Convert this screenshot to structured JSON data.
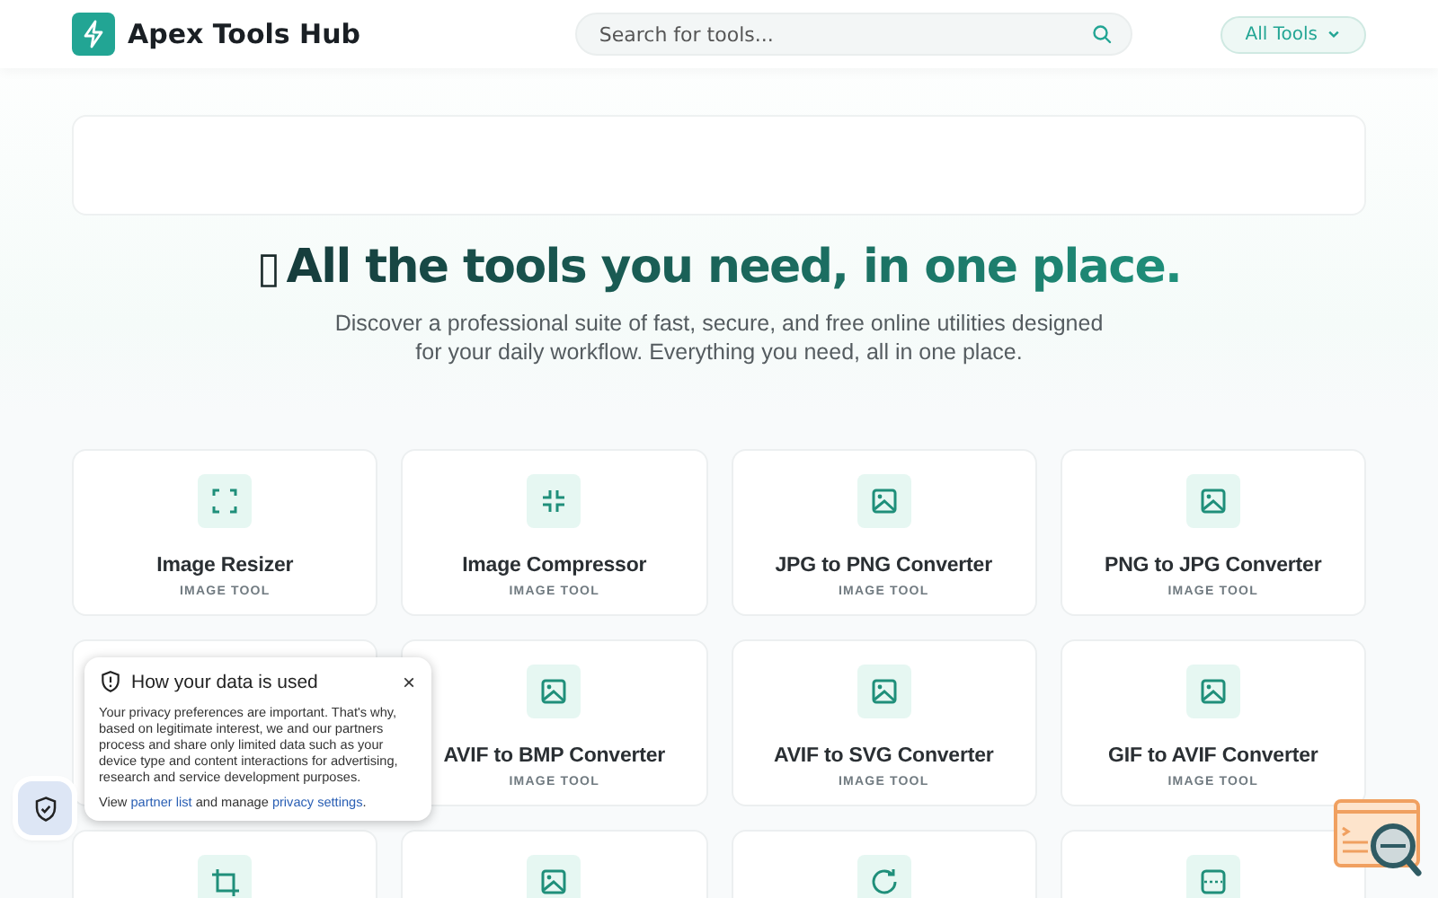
{
  "header": {
    "logo_text": "Apex Tools Hub",
    "search": {
      "placeholder": "Search for tools..."
    },
    "menu_button": "All Tools"
  },
  "hero": {
    "glyph": "▯",
    "title": "All the tools you need, in one place.",
    "subtitle": "Discover a professional suite of fast, secure, and free online utilities designed for your daily workflow. Everything you need, all in one place."
  },
  "tools": [
    {
      "kind": "expand",
      "name": "Image Resizer",
      "category": "IMAGE TOOL"
    },
    {
      "kind": "compress",
      "name": "Image Compressor",
      "category": "IMAGE TOOL"
    },
    {
      "kind": "image",
      "name": "JPG to PNG Converter",
      "category": "IMAGE TOOL"
    },
    {
      "kind": "image",
      "name": "PNG to JPG Converter",
      "category": "IMAGE TOOL"
    },
    {
      "kind": "covered"
    },
    {
      "kind": "image",
      "name": "AVIF to BMP Converter",
      "category": "IMAGE TOOL"
    },
    {
      "kind": "image",
      "name": "AVIF to SVG Converter",
      "category": "IMAGE TOOL"
    },
    {
      "kind": "image",
      "name": "GIF to AVIF Converter",
      "category": "IMAGE TOOL"
    },
    {
      "kind": "crop"
    },
    {
      "kind": "image"
    },
    {
      "kind": "rotate"
    },
    {
      "kind": "scan"
    }
  ],
  "consent": {
    "title": "How your data is used",
    "close": "×",
    "body": "Your privacy preferences are important. That's why, based on legitimate interest, we and our partners process and share only limited data such as your device type and content interactions for advertising, research and service development purposes.",
    "links_line": {
      "before": "View",
      "link1": "partner list",
      "middle": "and manage",
      "link2": "privacy settings",
      "after": "."
    }
  }
}
